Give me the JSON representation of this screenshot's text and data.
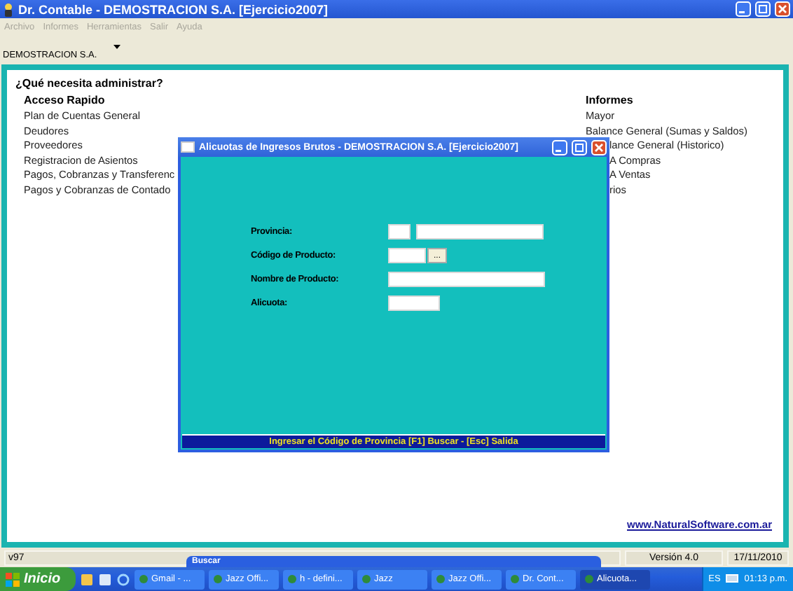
{
  "window": {
    "title": "Dr. Contable - DEMOSTRACION S.A.  [Ejercicio2007]"
  },
  "menu": [
    "Archivo",
    "Informes",
    "Herramientas",
    "Salir",
    "Ayuda"
  ],
  "company": "DEMOSTRACION S.A.",
  "heading": "¿Qué necesita administrar?",
  "columns": [
    {
      "title": "Acceso Rapido",
      "items": [
        {
          "label": "Plan de Cuentas General",
          "kind": "full"
        },
        {
          "label": "Deudores",
          "kind": "full"
        },
        {
          "label": "Proveedores",
          "kind": "full"
        },
        {
          "label": "Registracion de Asientos",
          "kind": "full"
        },
        {
          "label": "Pagos, Cobranzas y Transferenc",
          "kind": "full"
        },
        {
          "label": "Pagos y Cobranzas de Contado",
          "kind": "full"
        }
      ]
    },
    {
      "title": "Informes",
      "items": [
        {
          "label": "Mayor",
          "kind": "full"
        },
        {
          "label": "Balance General (Sumas y Saldos)",
          "kind": "full"
        },
        {
          "label": "lance General (Historico)",
          "kind": "partial"
        },
        {
          "label": "A Compras",
          "kind": "partial"
        },
        {
          "label": "A Ventas",
          "kind": "partial"
        },
        {
          "label": "rios",
          "kind": "partial"
        }
      ]
    }
  ],
  "link": "www.NaturalSoftware.com.ar",
  "dialog": {
    "title": "Alicuotas de Ingresos Brutos - DEMOSTRACION S.A.  [Ejercicio2007]",
    "fields": [
      {
        "label": "Provincia:",
        "kind": "code-name"
      },
      {
        "label": "Código de Producto:",
        "kind": "lookup",
        "button": "..."
      },
      {
        "label": "Nombre de Producto:",
        "kind": "wide"
      },
      {
        "label": "Alicuota:",
        "kind": "short"
      }
    ],
    "status": "Ingresar el Código de Provincia [F1] Buscar - [Esc] Salida"
  },
  "status_bar": {
    "left": "v97",
    "version": "Versión 4.0",
    "date": "17/11/2010"
  },
  "behind_window": {
    "title": "Buscar"
  },
  "taskbar": {
    "start": "Inicio",
    "tasks": [
      {
        "label": "Gmail - ...",
        "selected": false
      },
      {
        "label": "Jazz Offi...",
        "selected": false
      },
      {
        "label": "h - defini...",
        "selected": false
      },
      {
        "label": "Jazz",
        "selected": false
      },
      {
        "label": "Jazz Offi...",
        "selected": false
      },
      {
        "label": "Dr. Cont...",
        "selected": false
      },
      {
        "label": "Alicuota...",
        "selected": true
      }
    ],
    "language": "ES",
    "clock": "01:13 p.m."
  }
}
